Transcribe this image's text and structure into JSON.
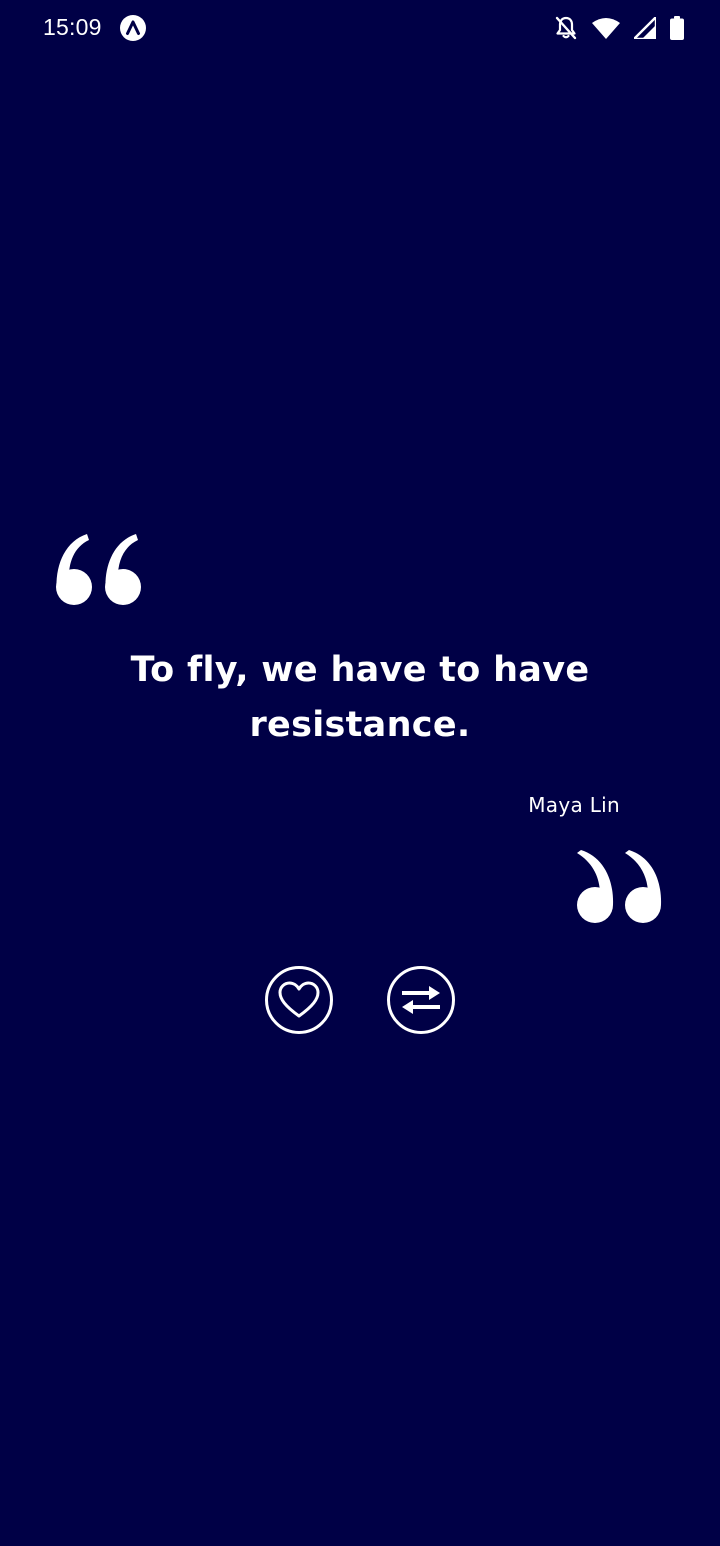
{
  "status_bar": {
    "time": "15:09",
    "icons": [
      "app-notification-icon",
      "bell-off-icon",
      "wifi-icon",
      "signal-icon",
      "battery-icon"
    ]
  },
  "quote": {
    "text": "To fly, we have to have resistance.",
    "author": "Maya Lin"
  },
  "actions": {
    "like_icon": "heart-icon",
    "next_icon": "swap-arrows-icon"
  },
  "colors": {
    "background": "#000046",
    "foreground": "#ffffff"
  }
}
